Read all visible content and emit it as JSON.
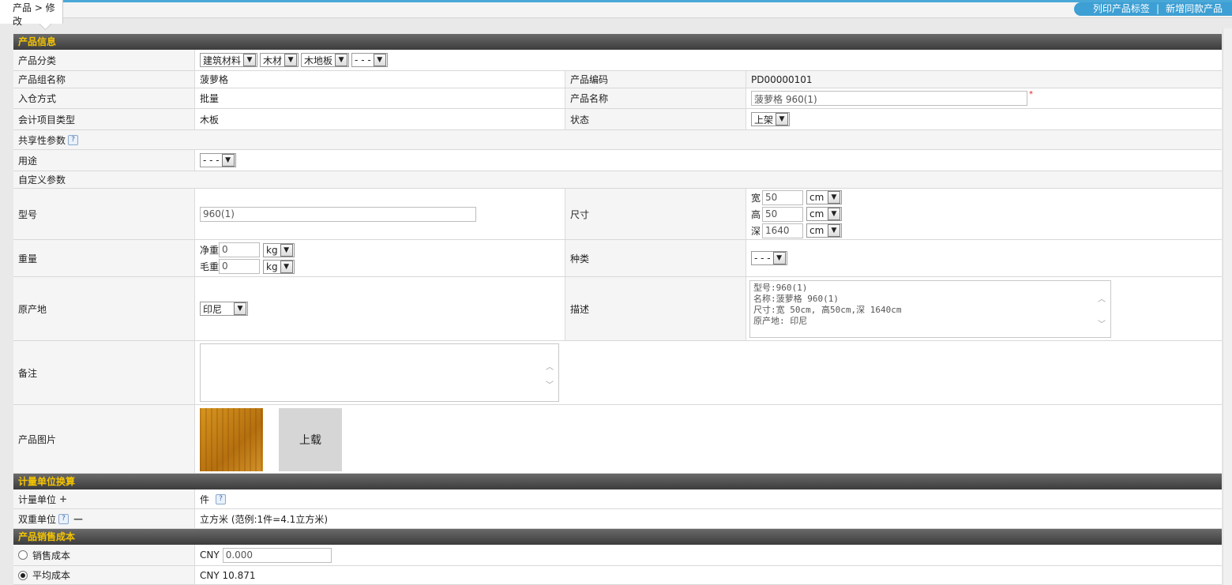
{
  "header": {
    "breadcrumb": "产品 > 修改",
    "link_print": "列印产品标签",
    "link_separator": "|",
    "link_new": "新增同款产品"
  },
  "sections": {
    "product_info": "产品信息",
    "unit_conversion": "计量单位换算",
    "sales_cost": "产品销售成本"
  },
  "category": {
    "label": "产品分类",
    "selects": [
      "建筑材料",
      "木材",
      "木地板",
      "- - -"
    ]
  },
  "group": {
    "label": "产品组名称",
    "value": "菠萝格"
  },
  "code": {
    "label": "产品编码",
    "value": "PD00000101"
  },
  "stock_method": {
    "label": "入仓方式",
    "value": "批量"
  },
  "name": {
    "label": "产品名称",
    "value": "菠萝格 960(1)",
    "required": "*"
  },
  "accounting": {
    "label": "会计项目类型",
    "value": "木板"
  },
  "status": {
    "label": "状态",
    "value": "上架"
  },
  "shared_params": {
    "label": "共享性参数",
    "help": "?"
  },
  "usage": {
    "label": "用途",
    "value": "- - -"
  },
  "custom_params": {
    "label": "自定义参数"
  },
  "model": {
    "label": "型号",
    "value": "960(1)"
  },
  "size": {
    "label": "尺寸",
    "dims": [
      {
        "key": "宽",
        "value": "50",
        "unit": "cm"
      },
      {
        "key": "高",
        "value": "50",
        "unit": "cm"
      },
      {
        "key": "深",
        "value": "1640",
        "unit": "cm"
      }
    ]
  },
  "weight": {
    "label": "重量",
    "net_label": "净重",
    "net_value": "0",
    "net_unit": "kg",
    "gross_label": "毛重",
    "gross_value": "0",
    "gross_unit": "kg"
  },
  "kind": {
    "label": "种类",
    "value": "- - -"
  },
  "origin": {
    "label": "原产地",
    "value": "印尼"
  },
  "description": {
    "label": "描述",
    "lines": [
      "型号:960(1)",
      "名称:菠萝格 960(1)",
      "尺寸:宽 50cm, 高50cm,深 1640cm",
      "原产地: 印尼"
    ]
  },
  "remark": {
    "label": "备注",
    "value": ""
  },
  "image": {
    "label": "产品图片",
    "upload_label": "上载"
  },
  "unit": {
    "label": "计量单位",
    "plus": "+",
    "value": "件",
    "help": "?"
  },
  "dual_unit": {
    "label": "双重单位",
    "help": "?",
    "minus": "—",
    "value": "立方米 (范例:1件=4.1立方米)"
  },
  "sales_cost_opt": {
    "label": "销售成本",
    "currency": "CNY",
    "value": "0.000",
    "selected": false
  },
  "avg_cost_opt": {
    "label": "平均成本",
    "value": "CNY 10.871",
    "selected": true
  }
}
